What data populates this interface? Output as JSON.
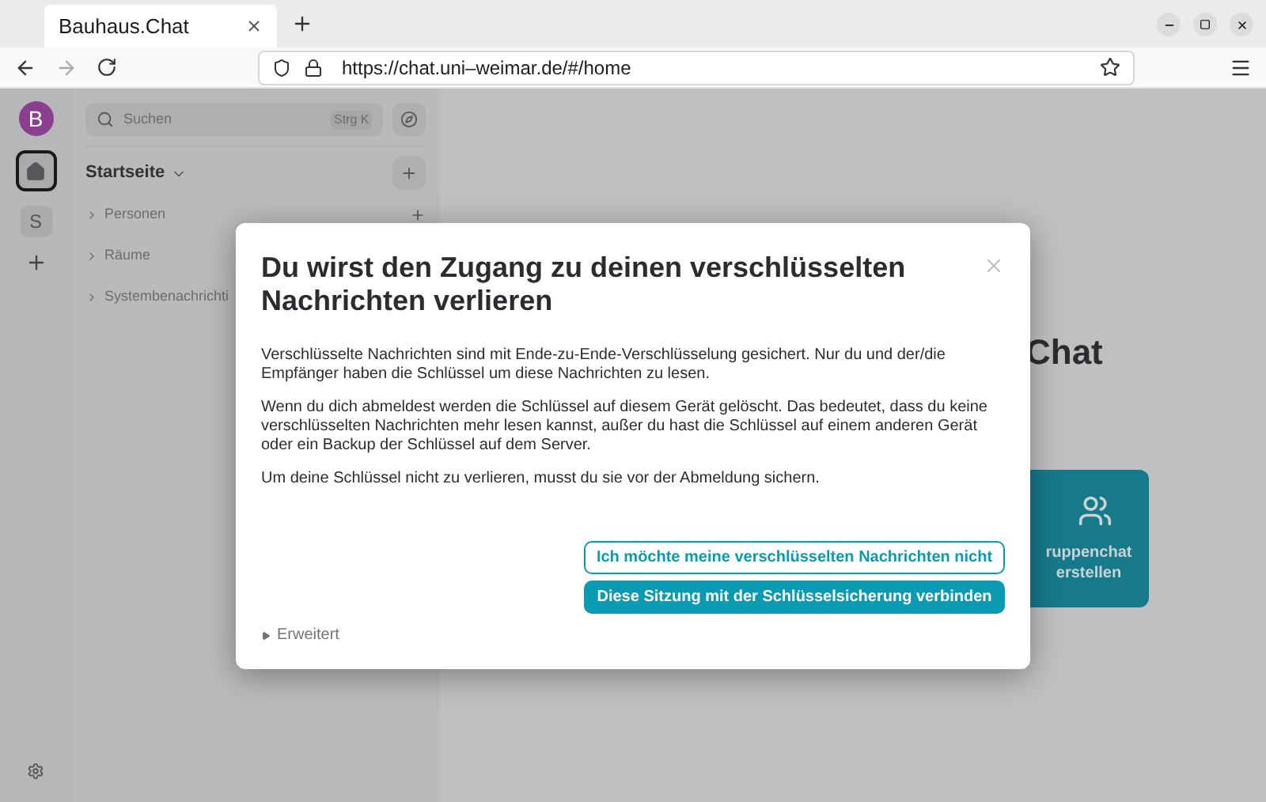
{
  "browser": {
    "tab": {
      "title": "Bauhaus.Chat",
      "selected": true
    },
    "url": "https://chat.uni–weimar.de/#/home"
  },
  "space_rail": {
    "avatar": "B",
    "spaces": [
      {
        "label": "S",
        "selected": false
      }
    ]
  },
  "room_list": {
    "search": {
      "placeholder": "Suchen",
      "shortcut": "Strg K"
    },
    "title": "Startseite",
    "sections": [
      {
        "label": "Personen",
        "expanded": false
      },
      {
        "label": "Räume",
        "expanded": false
      },
      {
        "label": "Systembenachrichti",
        "expanded": false
      }
    ]
  },
  "main": {
    "heading": "Chat",
    "card": {
      "lines": [
        "ruppenchat",
        "erstellen"
      ]
    }
  },
  "dialog": {
    "title": "Du wirst den Zugang zu deinen verschlüsselten Nachrichten verlieren",
    "paragraphs": [
      "Verschlüsselte Nachrichten sind mit Ende-zu-Ende-Verschlüsselung gesichert. Nur du und der/die Empfänger haben die Schlüssel um diese Nachrichten zu lesen.",
      "Wenn du dich abmeldest werden die Schlüssel auf diesem Gerät gelöscht. Das bedeutet, dass du keine verschlüsselten Nachrichten mehr lesen kannst, außer du hast die Schlüssel auf einem anderen Gerät oder ein Backup der Schlüssel auf dem Server.",
      "Um deine Schlüssel nicht zu verlieren, musst du sie vor der Abmeldung sichern."
    ],
    "buttons": [
      {
        "label": "Ich möchte meine verschlüsselten Nachrichten nicht",
        "kind": "outline"
      },
      {
        "label": "Diese Sitzung mit der Schlüsselsicherung verbinden",
        "kind": "primary"
      }
    ],
    "advanced": {
      "label": "Erweitert",
      "expanded": false
    }
  }
}
